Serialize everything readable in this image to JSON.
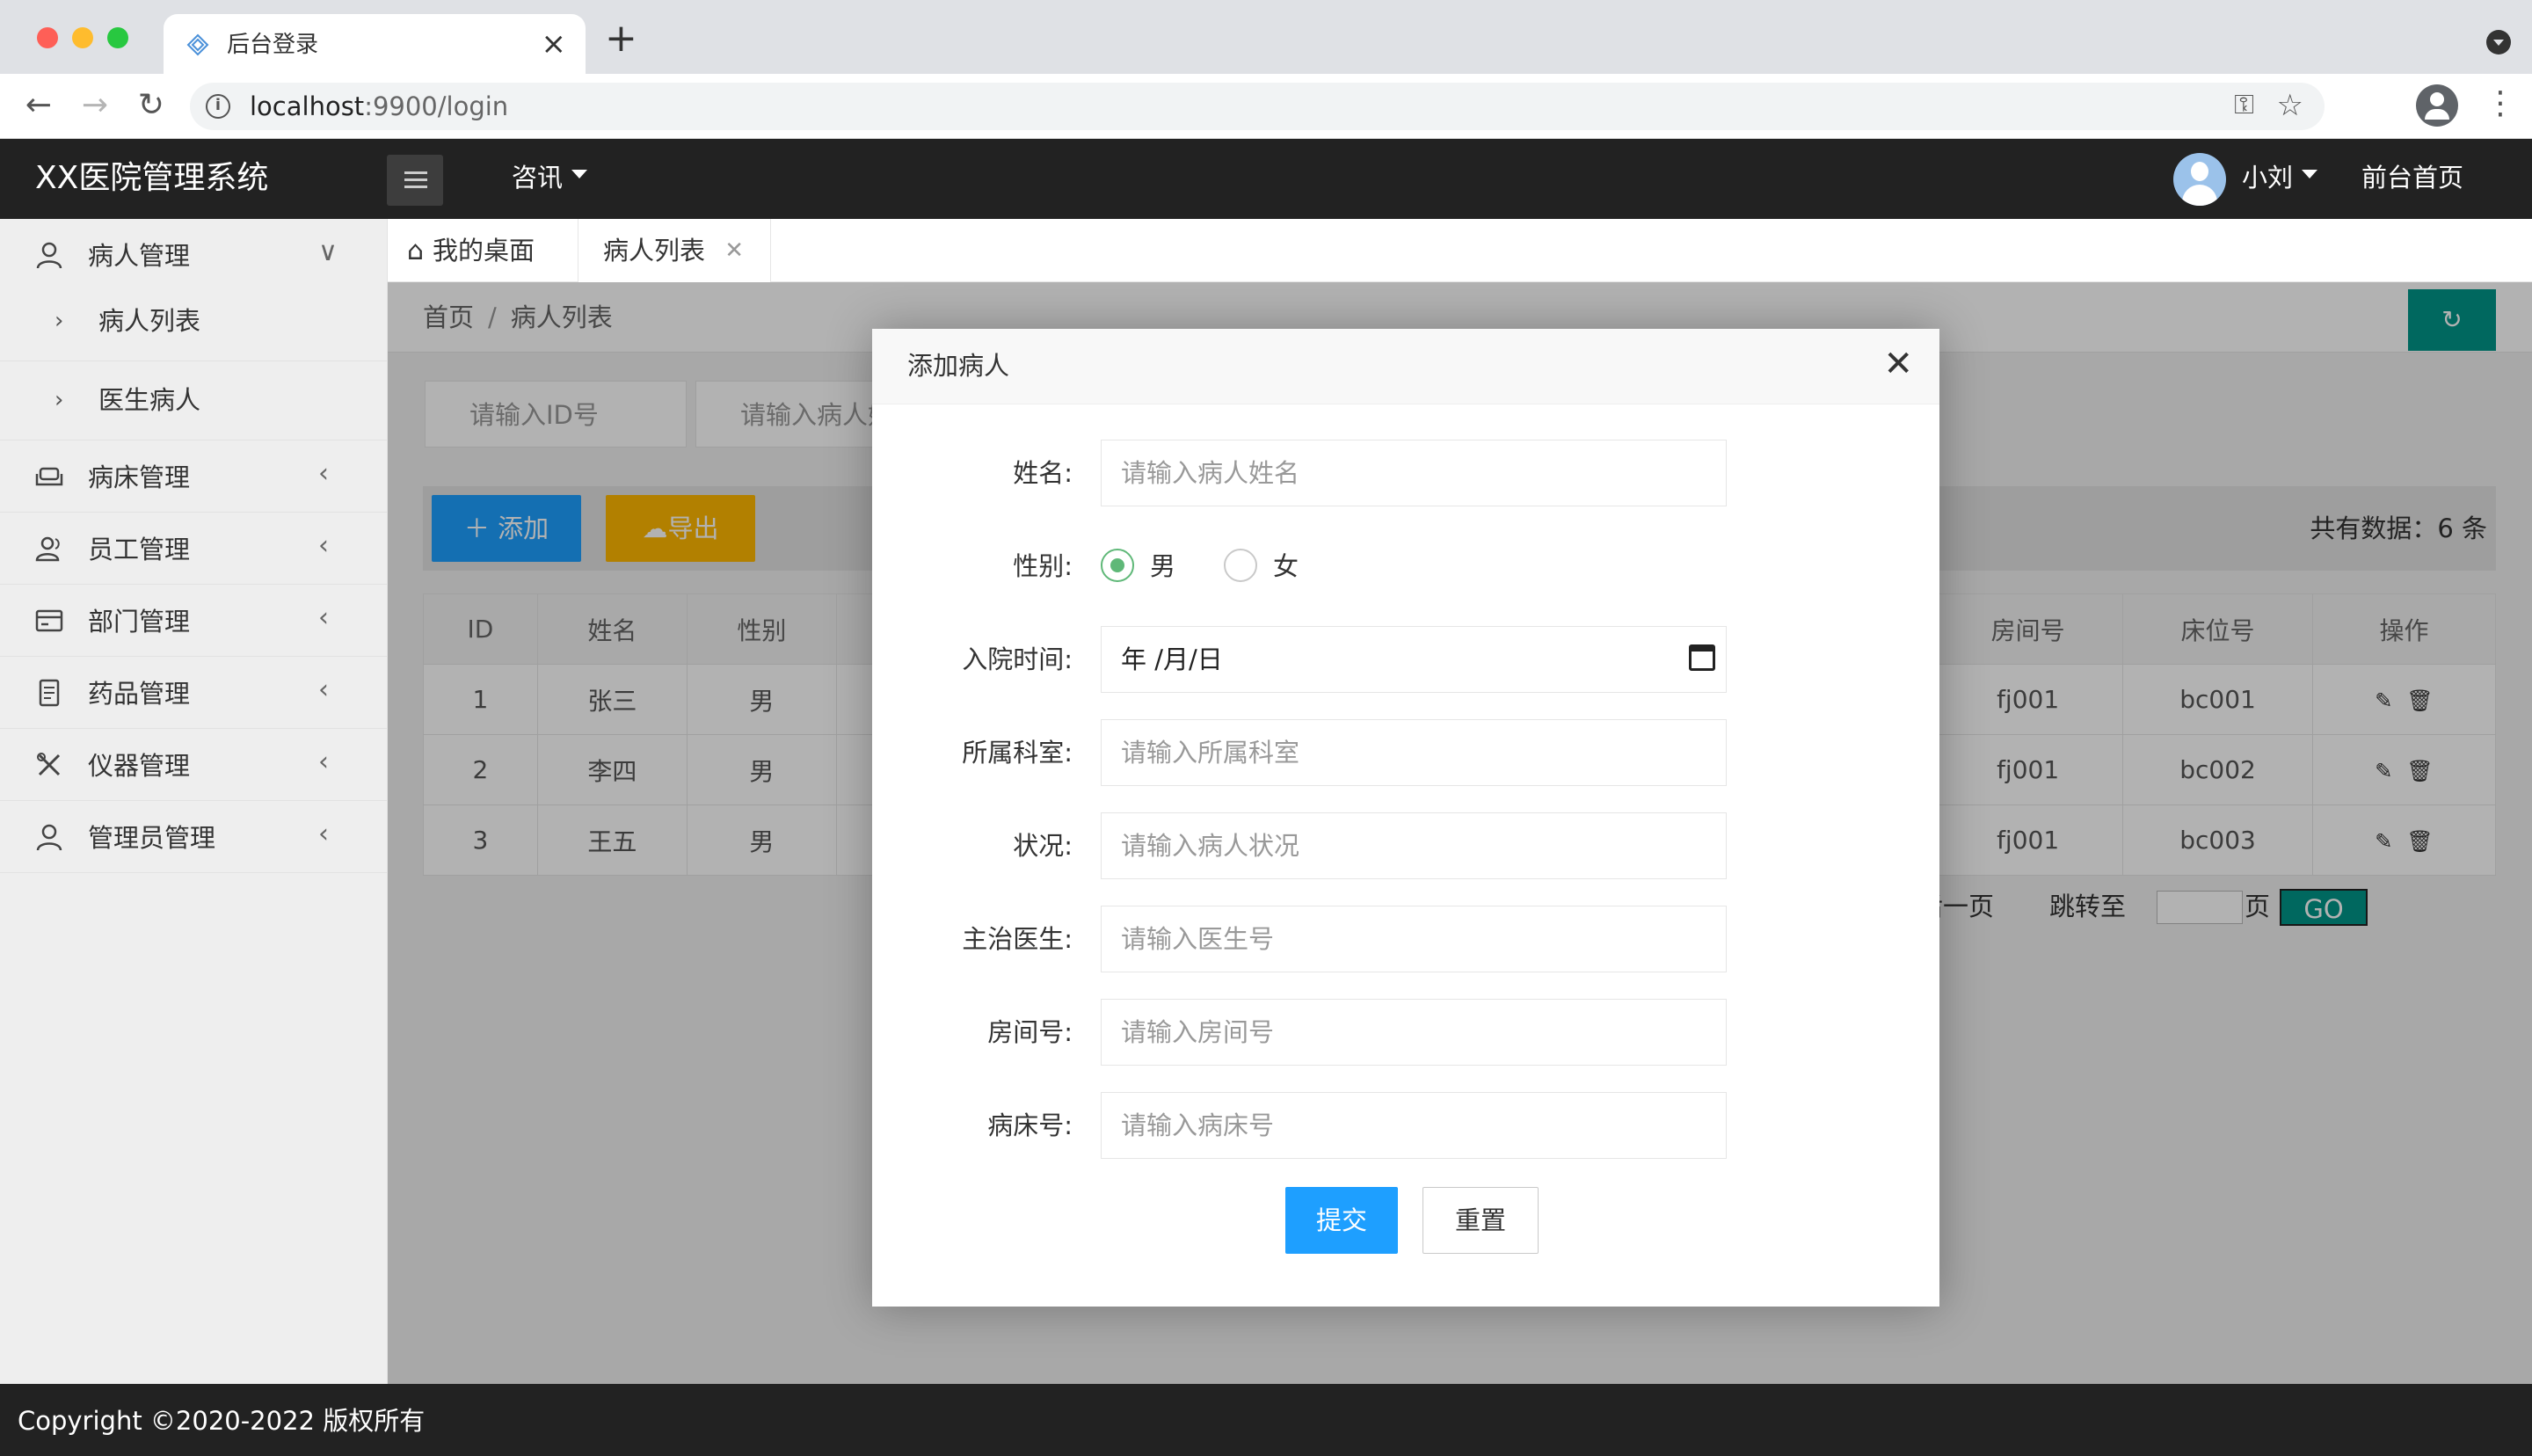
{
  "browser": {
    "tab_title": "后台登录",
    "tab_close": "×",
    "new_tab": "+",
    "url_host": "localhost",
    "url_rest": ":9900/login"
  },
  "header": {
    "app_title": "XX医院管理系统",
    "nav_info": "咨讯",
    "user_name": "小刘",
    "front_home": "前台首页"
  },
  "sidebar": {
    "groups": [
      {
        "label": "病人管理",
        "icon": "user-icon",
        "expanded": true
      },
      {
        "label": "病床管理",
        "icon": "sofa-icon"
      },
      {
        "label": "员工管理",
        "icon": "users-icon"
      },
      {
        "label": "部门管理",
        "icon": "card-icon"
      },
      {
        "label": "药品管理",
        "icon": "document-icon"
      },
      {
        "label": "仪器管理",
        "icon": "tools-icon"
      },
      {
        "label": "管理员管理",
        "icon": "admin-icon"
      }
    ],
    "sub_items": [
      {
        "label": "病人列表"
      },
      {
        "label": "医生病人"
      }
    ]
  },
  "tabs": {
    "home": "我的桌面",
    "active": "病人列表"
  },
  "breadcrumb": {
    "home": "首页",
    "sep": "/",
    "current": "病人列表"
  },
  "search": {
    "id_placeholder": "请输入ID号",
    "name_placeholder": "请输入病人姓名"
  },
  "toolbar": {
    "add_label": "添加",
    "export_label": "导出",
    "total_label": "共有数据：6 条"
  },
  "table": {
    "columns": [
      "ID",
      "姓名",
      "性别",
      "房间号",
      "床位号",
      "操作"
    ],
    "rows": [
      {
        "id": "1",
        "name": "张三",
        "gender": "男",
        "room": "fj001",
        "bed": "bc001"
      },
      {
        "id": "2",
        "name": "李四",
        "gender": "男",
        "room": "fj001",
        "bed": "bc002"
      },
      {
        "id": "3",
        "name": "王五",
        "gender": "男",
        "room": "fj001",
        "bed": "bc003"
      }
    ]
  },
  "pager": {
    "last_page": "后一页",
    "jump_to": "跳转至",
    "page_unit": "页",
    "go": "GO"
  },
  "modal": {
    "title": "添加病人",
    "fields": {
      "name": {
        "label": "姓名:",
        "placeholder": "请输入病人姓名"
      },
      "gender": {
        "label": "性别:",
        "options": [
          "男",
          "女"
        ],
        "selected": "男"
      },
      "admit_time": {
        "label": "入院时间:",
        "value": "年 /月/日"
      },
      "department": {
        "label": "所属科室:",
        "placeholder": "请输入所属科室"
      },
      "condition": {
        "label": "状况:",
        "placeholder": "请输入病人状况"
      },
      "doctor": {
        "label": "主治医生:",
        "placeholder": "请输入医生号"
      },
      "room": {
        "label": "房间号:",
        "placeholder": "请输入房间号"
      },
      "bed": {
        "label": "病床号:",
        "placeholder": "请输入病床号"
      }
    },
    "submit_label": "提交",
    "reset_label": "重置"
  },
  "footer": {
    "copyright": "Copyright ©2020-2022 版权所有"
  },
  "colors": {
    "header_bg": "#222222",
    "primary_blue": "#1e9fff",
    "warm_yellow": "#ffb800",
    "teal": "#009688",
    "radio_green": "#5fb878"
  }
}
